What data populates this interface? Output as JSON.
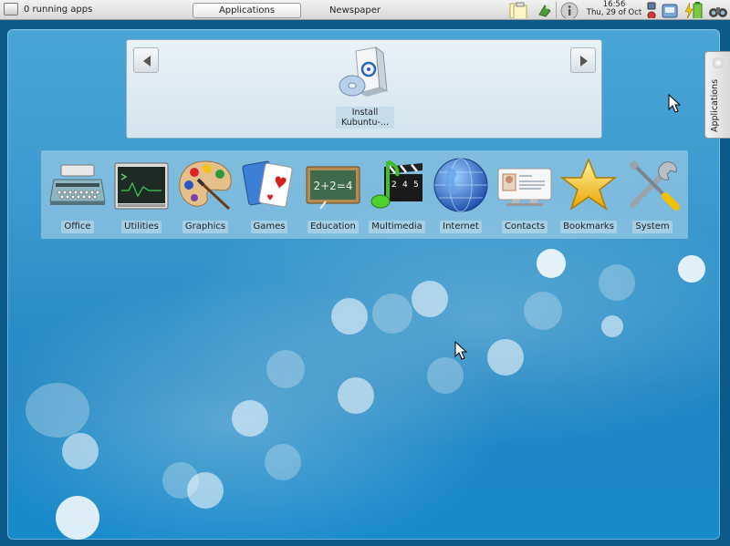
{
  "panel": {
    "running_apps": "0 running apps",
    "tabs": [
      {
        "label": "Applications",
        "active": true
      },
      {
        "label": "Newspaper",
        "active": false
      }
    ],
    "clock": {
      "time": "16:56",
      "date": "Thu, 29 of Oct"
    },
    "tray_icons": [
      "notes-icon",
      "network-icon",
      "info-icon",
      "device-notifier-icon",
      "battery-icon",
      "binoculars-icon"
    ]
  },
  "favorites": {
    "items": [
      {
        "label": "Install Kubuntu-...",
        "icon": "install-cd-icon"
      }
    ]
  },
  "categories": [
    {
      "label": "Office",
      "icon": "typewriter-icon"
    },
    {
      "label": "Utilities",
      "icon": "terminal-icon"
    },
    {
      "label": "Graphics",
      "icon": "palette-icon"
    },
    {
      "label": "Games",
      "icon": "cards-icon"
    },
    {
      "label": "Education",
      "icon": "chalkboard-icon"
    },
    {
      "label": "Multimedia",
      "icon": "clapper-music-icon"
    },
    {
      "label": "Internet",
      "icon": "globe-icon"
    },
    {
      "label": "Contacts",
      "icon": "contact-card-icon"
    },
    {
      "label": "Bookmarks",
      "icon": "star-icon"
    },
    {
      "label": "System",
      "icon": "tools-icon"
    }
  ],
  "side_tab": {
    "label": "Applications"
  },
  "chalkboard_text": "2+2=4",
  "slate_digits": [
    "2",
    "4",
    "5"
  ],
  "colors": {
    "accent": "#1f86c2",
    "panel": "#e4e4e4"
  }
}
